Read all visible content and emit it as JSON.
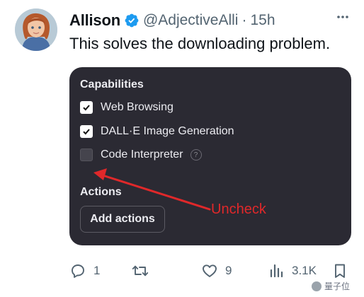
{
  "post": {
    "author_name": "Allison",
    "handle": "@AdjectiveAlli",
    "separator": "·",
    "time": "15h",
    "text": "This solves the downloading problem."
  },
  "embedded_screenshot": {
    "capabilities_heading": "Capabilities",
    "capabilities": [
      {
        "label": "Web Browsing",
        "checked": true
      },
      {
        "label": "DALL·E Image Generation",
        "checked": true
      },
      {
        "label": "Code Interpreter",
        "checked": false,
        "help_icon": "?"
      }
    ],
    "actions_heading": "Actions",
    "add_actions_label": "Add actions",
    "annotation_text": "Uncheck"
  },
  "engagement": {
    "replies": "1",
    "reposts": "",
    "likes": "9",
    "views": "3.1K"
  },
  "icons": {
    "verified": "verified-badge-icon",
    "more": "more-options-icon",
    "reply": "reply-icon",
    "repost": "repost-icon",
    "like": "heart-icon",
    "views": "views-icon",
    "bookmark": "bookmark-icon"
  },
  "watermark": {
    "text": "量子位"
  },
  "colors": {
    "verified_blue": "#1d9bf0",
    "panel_background": "#2b2a33",
    "annotation_red": "#e0282a",
    "muted_text": "#536471"
  }
}
